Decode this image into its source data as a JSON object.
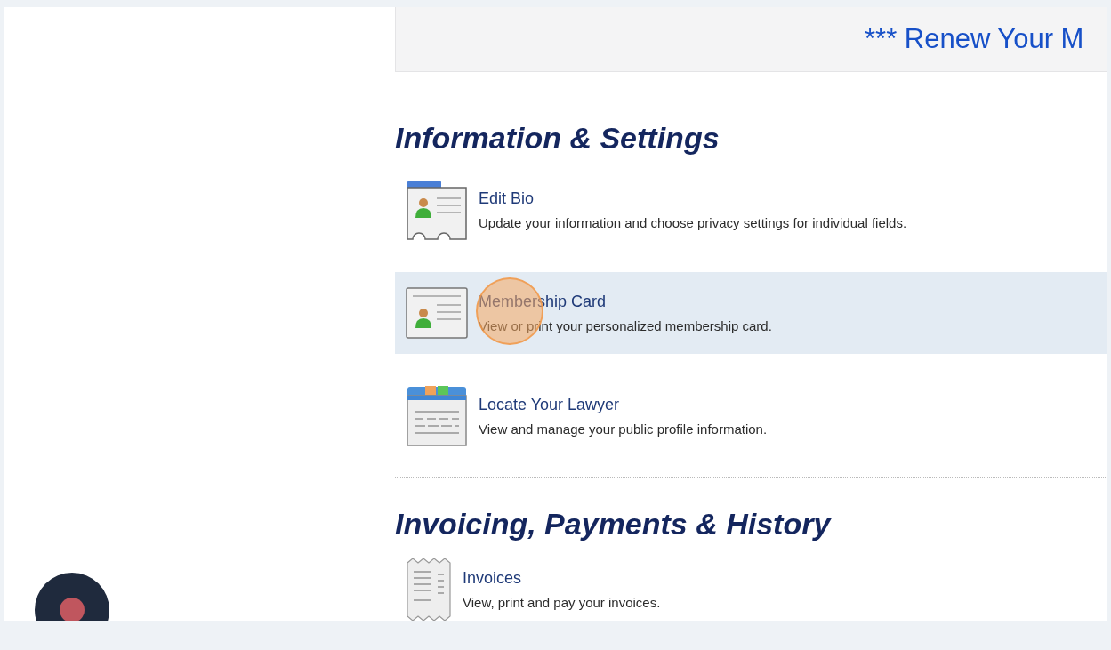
{
  "banner": {
    "text": "*** Renew Your M"
  },
  "sections": [
    {
      "title": "Information & Settings",
      "items": [
        {
          "kind": "bio",
          "title": "Edit Bio",
          "description": "Update your information and choose privacy settings for individual fields.",
          "selected": false,
          "cursor_highlight": false
        },
        {
          "kind": "card",
          "title": "Membership Card",
          "description": "View or print your personalized membership card.",
          "selected": true,
          "cursor_highlight": true
        },
        {
          "kind": "folder",
          "title": "Locate Your Lawyer",
          "description": "View and manage your public profile information.",
          "selected": false,
          "cursor_highlight": false
        }
      ]
    },
    {
      "title": "Invoicing, Payments & History",
      "items": [
        {
          "kind": "receipt",
          "title": "Invoices",
          "description": "View, print and pay your invoices.",
          "selected": false,
          "cursor_highlight": false
        }
      ]
    }
  ]
}
